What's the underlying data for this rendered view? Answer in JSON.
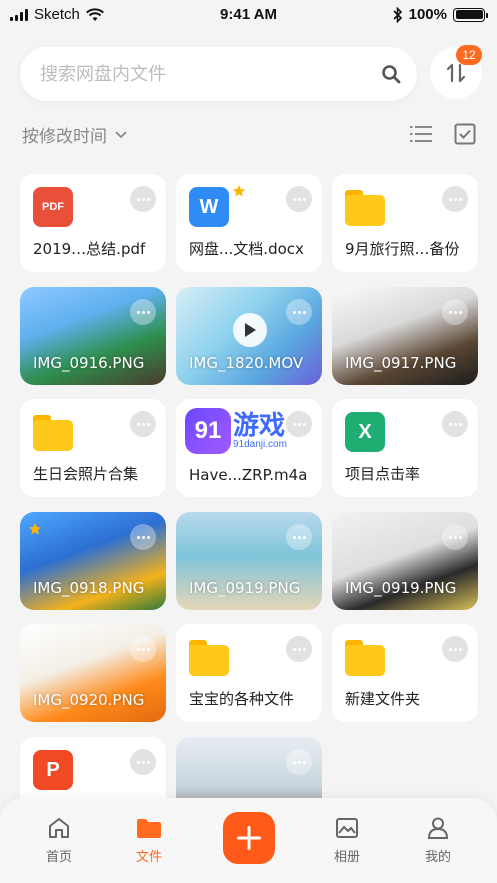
{
  "status_bar": {
    "carrier": "Sketch",
    "time": "9:41 AM",
    "battery": "100%"
  },
  "search": {
    "placeholder": "搜索网盘内文件"
  },
  "sort_badge": "12",
  "sort": {
    "label": "按修改时间"
  },
  "files": [
    {
      "name": "2019…总结.pdf",
      "kind": "pdf",
      "icon_text": "PDF"
    },
    {
      "name": "网盘...文档.docx",
      "kind": "word",
      "icon_text": "W",
      "starred": true
    },
    {
      "name": "9月旅行照…备份",
      "kind": "folder"
    },
    {
      "name": "IMG_0916.PNG",
      "kind": "image"
    },
    {
      "name": "IMG_1820.MOV",
      "kind": "video"
    },
    {
      "name": "IMG_0917.PNG",
      "kind": "image"
    },
    {
      "name": "生日会照片合集",
      "kind": "folder"
    },
    {
      "name": "Have...ZRP.m4a",
      "kind": "audio"
    },
    {
      "name": "项目点击率",
      "kind": "excel",
      "icon_text": "X"
    },
    {
      "name": "IMG_0918.PNG",
      "kind": "image",
      "starred": true
    },
    {
      "name": "IMG_0919.PNG",
      "kind": "image"
    },
    {
      "name": "IMG_0919.PNG",
      "kind": "image"
    },
    {
      "name": "IMG_0920.PNG",
      "kind": "image"
    },
    {
      "name": "宝宝的各种文件",
      "kind": "folder"
    },
    {
      "name": "新建文件夹",
      "kind": "folder"
    },
    {
      "name": "",
      "kind": "ppt",
      "icon_text": "P"
    },
    {
      "name": "",
      "kind": "image"
    }
  ],
  "watermark": {
    "logo_text": "91",
    "title": "游戏",
    "subtitle": "91danji.com"
  },
  "tabbar": {
    "home": "首页",
    "files": "文件",
    "album": "相册",
    "me": "我的"
  },
  "colors": {
    "accent": "#ff6a1f",
    "pdf": "#e8503a",
    "word": "#2f8cf5",
    "excel": "#1fae72",
    "ppt": "#f04a24",
    "folder": "#ffc81a"
  }
}
